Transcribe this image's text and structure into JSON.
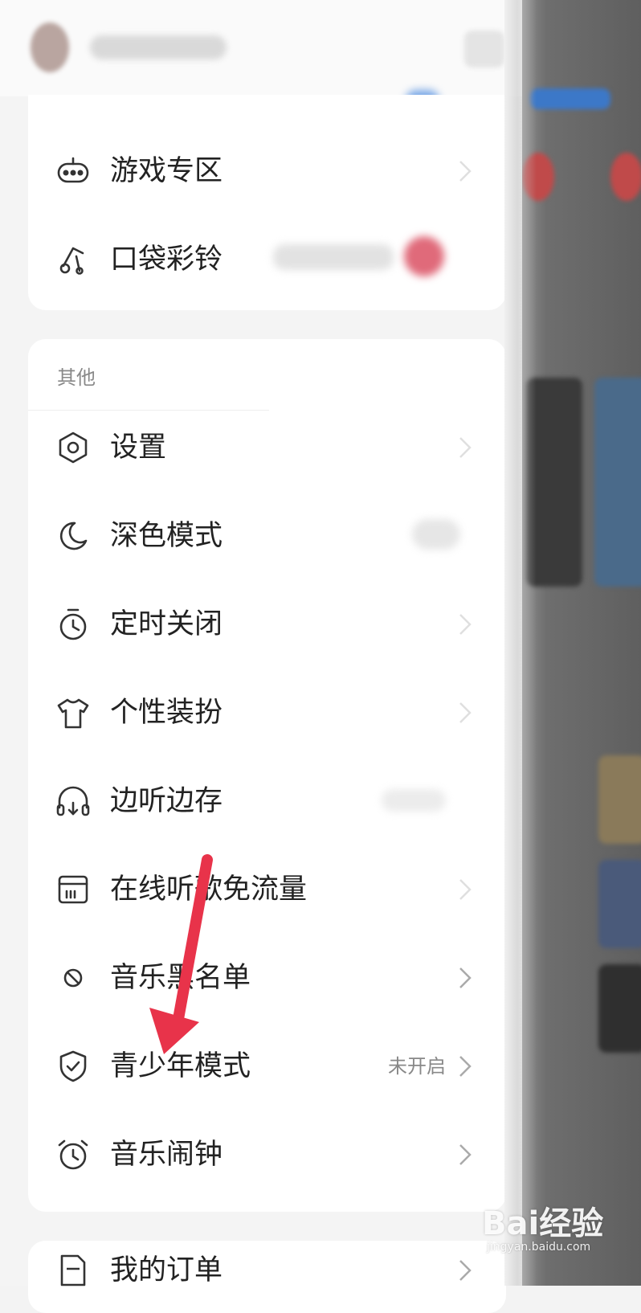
{
  "drawer": {
    "top_items": [
      {
        "label": "游戏专区",
        "icon": "gamepad-icon"
      },
      {
        "label": "口袋彩铃",
        "icon": "music-note-icon"
      }
    ],
    "other_section": {
      "title": "其他",
      "items": [
        {
          "label": "设置",
          "icon": "settings-hexagon-icon",
          "status": ""
        },
        {
          "label": "深色模式",
          "icon": "moon-icon",
          "status": ""
        },
        {
          "label": "定时关闭",
          "icon": "timer-icon",
          "status": ""
        },
        {
          "label": "个性装扮",
          "icon": "tshirt-icon",
          "status": ""
        },
        {
          "label": "边听边存",
          "icon": "headphones-download-icon",
          "status": ""
        },
        {
          "label": "在线听歌免流量",
          "icon": "sim-card-icon",
          "status": ""
        },
        {
          "label": "音乐黑名单",
          "icon": "block-icon",
          "status": ""
        },
        {
          "label": "青少年模式",
          "icon": "shield-check-icon",
          "status": "未开启"
        },
        {
          "label": "音乐闹钟",
          "icon": "alarm-clock-icon",
          "status": ""
        }
      ]
    },
    "bottom_items": [
      {
        "label": "我的订单",
        "icon": "order-icon"
      }
    ]
  },
  "annotation": {
    "arrow_color": "#e8334a",
    "target": "青少年模式"
  },
  "watermark": {
    "brand": "Bai经验",
    "url": "jingyan.baidu.com"
  }
}
